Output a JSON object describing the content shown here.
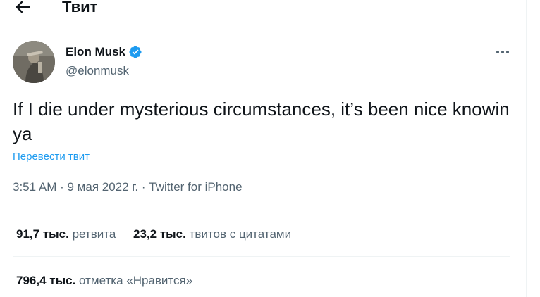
{
  "header": {
    "title": "Твит",
    "back_icon": "arrow-left-icon"
  },
  "author": {
    "name": "Elon Musk",
    "handle": "@elonmusk",
    "verified_icon": "verified-badge-icon",
    "verified_color": "#1d9bf0"
  },
  "tweet": {
    "text": "If I die under mysterious circumstances, it’s been nice knowin ya",
    "translate_label": "Перевести твит",
    "time": "3:51 AM",
    "date": "9 мая 2022 г.",
    "source": "Twitter for iPhone"
  },
  "stats": {
    "retweets_count": "91,7 тыс.",
    "retweets_label": "ретвита",
    "quotes_count": "23,2 тыс.",
    "quotes_label": "твитов с цитатами",
    "likes_count": "796,4 тыс.",
    "likes_label": "отметка «Нравится»"
  },
  "colors": {
    "accent": "#1d9bf0",
    "text_primary": "#0f1419",
    "text_secondary": "#536471",
    "divider": "#eff3f4"
  }
}
